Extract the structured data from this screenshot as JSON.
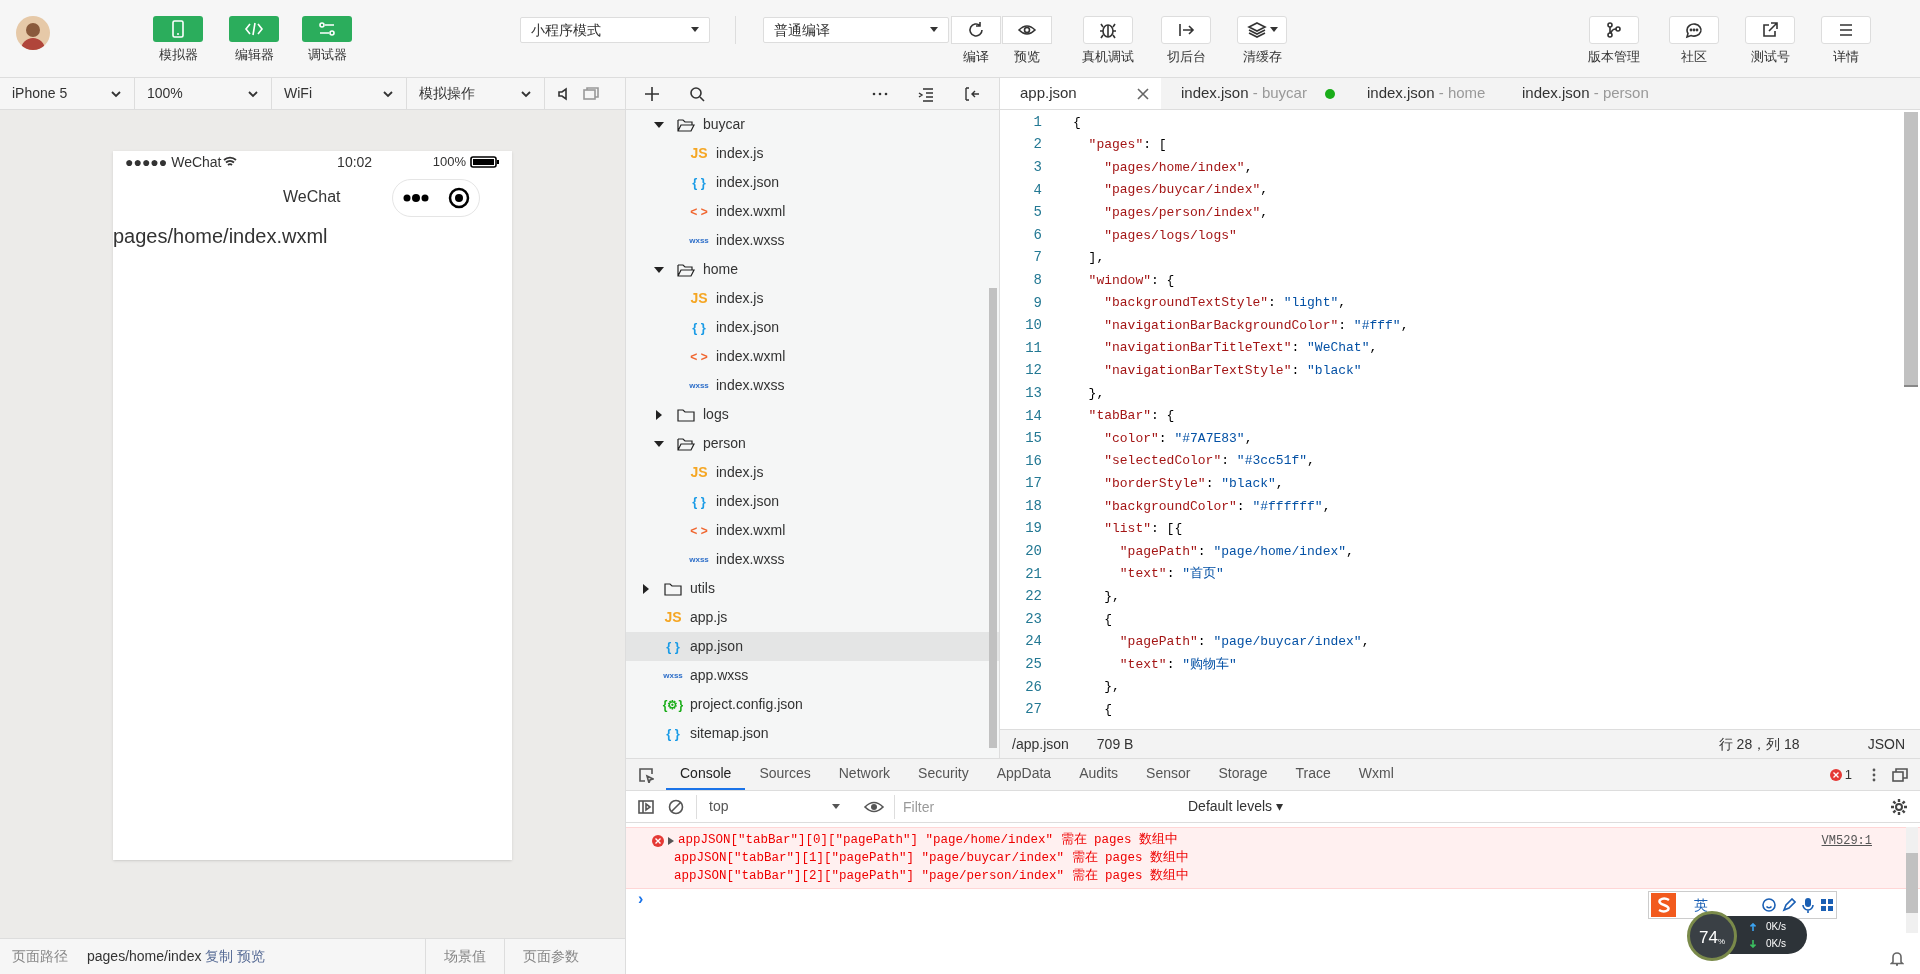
{
  "toolbar": {
    "views": [
      {
        "label": "模拟器",
        "kind": "phone",
        "selected": true
      },
      {
        "label": "编辑器",
        "kind": "code",
        "selected": true
      },
      {
        "label": "调试器",
        "kind": "debug",
        "selected": true
      }
    ],
    "mode_select": "小程序模式",
    "compile_select": "普通编译",
    "actions": [
      {
        "label": "编译",
        "kind": "refresh",
        "group": true
      },
      {
        "label": "预览",
        "kind": "eye",
        "group": true
      },
      {
        "label": "真机调试",
        "kind": "bug",
        "group": false
      },
      {
        "label": "切后台",
        "kind": "switch",
        "group": false
      },
      {
        "label": "清缓存",
        "kind": "layers",
        "group": false
      }
    ],
    "right_actions": [
      {
        "label": "版本管理",
        "kind": "branch"
      },
      {
        "label": "社区",
        "kind": "chat"
      },
      {
        "label": "测试号",
        "kind": "share"
      },
      {
        "label": "详情",
        "kind": "menu"
      }
    ]
  },
  "simulator": {
    "selects": [
      "iPhone 5",
      "100%",
      "WiFi",
      "模拟操作"
    ],
    "phone": {
      "carrier": "●●●●● WeChat",
      "time": "10:02",
      "battery": "100%",
      "title": "WeChat",
      "content": "pages/home/index.wxml"
    },
    "footer": {
      "path_label": "页面路径",
      "path": "pages/home/index",
      "copy": "复制",
      "preview": "预览",
      "scene": "场景值",
      "params": "页面参数"
    }
  },
  "file_tree": [
    {
      "children": [
        {
          "name": "buycar",
          "kind": "folder",
          "expanded": true,
          "children": [
            {
              "name": "index.js",
              "kind": "js",
              "icon": "JS"
            },
            {
              "name": "index.json",
              "kind": "json",
              "icon": "{ }"
            },
            {
              "name": "index.wxml",
              "kind": "wxml",
              "icon": "< >"
            },
            {
              "name": "index.wxss",
              "kind": "wxss",
              "icon": "wxss"
            }
          ]
        },
        {
          "name": "home",
          "kind": "folder",
          "expanded": true,
          "children": [
            {
              "name": "index.js",
              "kind": "js",
              "icon": "JS"
            },
            {
              "name": "index.json",
              "kind": "json",
              "icon": "{ }"
            },
            {
              "name": "index.wxml",
              "kind": "wxml",
              "icon": "< >"
            },
            {
              "name": "index.wxss",
              "kind": "wxss",
              "icon": "wxss"
            }
          ]
        },
        {
          "name": "logs",
          "kind": "folder",
          "expanded": false
        },
        {
          "name": "person",
          "kind": "folder",
          "expanded": true,
          "children": [
            {
              "name": "index.js",
              "kind": "js",
              "icon": "JS"
            },
            {
              "name": "index.json",
              "kind": "json",
              "icon": "{ }"
            },
            {
              "name": "index.wxml",
              "kind": "wxml",
              "icon": "< >"
            },
            {
              "name": "index.wxss",
              "kind": "wxss",
              "icon": "wxss"
            }
          ]
        }
      ]
    },
    {
      "name": "utils",
      "kind": "folder",
      "expanded": false
    },
    {
      "name": "app.js",
      "kind": "js",
      "icon": "JS",
      "selected": false
    },
    {
      "name": "app.json",
      "kind": "json",
      "icon": "{ }",
      "selected": true
    },
    {
      "name": "app.wxss",
      "kind": "wxss",
      "icon": "wxss",
      "selected": false
    },
    {
      "name": "project.config.json",
      "kind": "config",
      "icon": "{⚙}",
      "selected": false
    },
    {
      "name": "sitemap.json",
      "kind": "json",
      "icon": "{ }",
      "selected": false
    }
  ],
  "editor": {
    "tabs": [
      {
        "file": "app.json",
        "selected": true,
        "modified": false
      },
      {
        "file": "index.json",
        "folder": " - buycar",
        "selected": false,
        "modified": true
      },
      {
        "file": "index.json",
        "folder": " - home",
        "selected": false,
        "modified": false
      },
      {
        "file": "index.json",
        "folder": " - person",
        "selected": false,
        "modified": false
      }
    ],
    "lines": [
      {
        "number": "1",
        "tokens": [
          {
            "kind": "punct",
            "text": "{"
          }
        ]
      },
      {
        "number": "2",
        "tokens": [
          {
            "kind": "key",
            "text": "  \"pages\""
          },
          {
            "kind": "punct",
            "text": ": ["
          }
        ]
      },
      {
        "number": "3",
        "tokens": [
          {
            "kind": "key",
            "text": "    \"pages/home/index\""
          },
          {
            "kind": "punct",
            "text": ","
          }
        ]
      },
      {
        "number": "4",
        "tokens": [
          {
            "kind": "key",
            "text": "    \"pages/buycar/index\""
          },
          {
            "kind": "punct",
            "text": ","
          }
        ]
      },
      {
        "number": "5",
        "tokens": [
          {
            "kind": "key",
            "text": "    \"pages/person/index\""
          },
          {
            "kind": "punct",
            "text": ","
          }
        ]
      },
      {
        "number": "6",
        "tokens": [
          {
            "kind": "key",
            "text": "    \"pages/logs/logs\""
          }
        ]
      },
      {
        "number": "7",
        "tokens": [
          {
            "kind": "punct",
            "text": "  ],"
          }
        ]
      },
      {
        "number": "8",
        "tokens": [
          {
            "kind": "key",
            "text": "  \"window\""
          },
          {
            "kind": "punct",
            "text": ": {"
          }
        ]
      },
      {
        "number": "9",
        "tokens": [
          {
            "kind": "key",
            "text": "    \"backgroundTextStyle\""
          },
          {
            "kind": "punct",
            "text": ": "
          },
          {
            "kind": "value",
            "text": "\"light\""
          },
          {
            "kind": "punct",
            "text": ","
          }
        ]
      },
      {
        "number": "10",
        "tokens": [
          {
            "kind": "key",
            "text": "    \"navigationBarBackgroundColor\""
          },
          {
            "kind": "punct",
            "text": ": "
          },
          {
            "kind": "value",
            "text": "\"#fff\""
          },
          {
            "kind": "punct",
            "text": ","
          }
        ]
      },
      {
        "number": "11",
        "tokens": [
          {
            "kind": "key",
            "text": "    \"navigationBarTitleText\""
          },
          {
            "kind": "punct",
            "text": ": "
          },
          {
            "kind": "value",
            "text": "\"WeChat\""
          },
          {
            "kind": "punct",
            "text": ","
          }
        ]
      },
      {
        "number": "12",
        "tokens": [
          {
            "kind": "key",
            "text": "    \"navigationBarTextStyle\""
          },
          {
            "kind": "punct",
            "text": ": "
          },
          {
            "kind": "value",
            "text": "\"black\""
          }
        ]
      },
      {
        "number": "13",
        "tokens": [
          {
            "kind": "punct",
            "text": "  },"
          }
        ]
      },
      {
        "number": "14",
        "tokens": [
          {
            "kind": "key",
            "text": "  \"tabBar\""
          },
          {
            "kind": "punct",
            "text": ": {"
          }
        ]
      },
      {
        "number": "15",
        "tokens": [
          {
            "kind": "key",
            "text": "    \"color\""
          },
          {
            "kind": "punct",
            "text": ": "
          },
          {
            "kind": "value",
            "text": "\"#7A7E83\""
          },
          {
            "kind": "punct",
            "text": ","
          }
        ]
      },
      {
        "number": "16",
        "tokens": [
          {
            "kind": "key",
            "text": "    \"selectedColor\""
          },
          {
            "kind": "punct",
            "text": ": "
          },
          {
            "kind": "value",
            "text": "\"#3cc51f\""
          },
          {
            "kind": "punct",
            "text": ","
          }
        ]
      },
      {
        "number": "17",
        "tokens": [
          {
            "kind": "key",
            "text": "    \"borderStyle\""
          },
          {
            "kind": "punct",
            "text": ": "
          },
          {
            "kind": "value",
            "text": "\"black\""
          },
          {
            "kind": "punct",
            "text": ","
          }
        ]
      },
      {
        "number": "18",
        "tokens": [
          {
            "kind": "key",
            "text": "    \"backgroundColor\""
          },
          {
            "kind": "punct",
            "text": ": "
          },
          {
            "kind": "value",
            "text": "\"#ffffff\""
          },
          {
            "kind": "punct",
            "text": ","
          }
        ]
      },
      {
        "number": "19",
        "tokens": [
          {
            "kind": "key",
            "text": "    \"list\""
          },
          {
            "kind": "punct",
            "text": ": [{"
          }
        ]
      },
      {
        "number": "20",
        "tokens": [
          {
            "kind": "key",
            "text": "      \"pagePath\""
          },
          {
            "kind": "punct",
            "text": ": "
          },
          {
            "kind": "value",
            "text": "\"page/home/index\""
          },
          {
            "kind": "punct",
            "text": ","
          }
        ]
      },
      {
        "number": "21",
        "tokens": [
          {
            "kind": "key",
            "text": "      \"text\""
          },
          {
            "kind": "punct",
            "text": ": "
          },
          {
            "kind": "value",
            "text": "\"首页\""
          }
        ]
      },
      {
        "number": "22",
        "tokens": [
          {
            "kind": "punct",
            "text": "    },"
          }
        ]
      },
      {
        "number": "23",
        "tokens": [
          {
            "kind": "punct",
            "text": "    {"
          }
        ]
      },
      {
        "number": "24",
        "tokens": [
          {
            "kind": "key",
            "text": "      \"pagePath\""
          },
          {
            "kind": "punct",
            "text": ": "
          },
          {
            "kind": "value",
            "text": "\"page/buycar/index\""
          },
          {
            "kind": "punct",
            "text": ","
          }
        ]
      },
      {
        "number": "25",
        "tokens": [
          {
            "kind": "key",
            "text": "      \"text\""
          },
          {
            "kind": "punct",
            "text": ": "
          },
          {
            "kind": "value",
            "text": "\"购物车\""
          }
        ]
      },
      {
        "number": "26",
        "tokens": [
          {
            "kind": "punct",
            "text": "    },"
          }
        ]
      },
      {
        "number": "27",
        "tokens": [
          {
            "kind": "punct",
            "text": "    {"
          }
        ]
      }
    ],
    "status": {
      "path": "/app.json",
      "size": "709 B",
      "cursor": "行 28，列 18",
      "language": "JSON"
    }
  },
  "devtools": {
    "tabs": [
      {
        "label": "Console",
        "selected": true
      },
      {
        "label": "Sources",
        "selected": false
      },
      {
        "label": "Network",
        "selected": false
      },
      {
        "label": "Security",
        "selected": false
      },
      {
        "label": "AppData",
        "selected": false
      },
      {
        "label": "Audits",
        "selected": false
      },
      {
        "label": "Sensor",
        "selected": false
      },
      {
        "label": "Storage",
        "selected": false
      },
      {
        "label": "Trace",
        "selected": false
      },
      {
        "label": "Wxml",
        "selected": false
      }
    ],
    "error_count": "1",
    "context": "top",
    "filter_placeholder": "Filter",
    "levels": "Default levels ▾",
    "messages": [
      {
        "kind": "error",
        "lines": [
          "appJSON[\"tabBar\"][0][\"pagePath\"] \"page/home/index\" 需在 pages 数组中",
          "appJSON[\"tabBar\"][1][\"pagePath\"] \"page/buycar/index\" 需在 pages 数组中",
          "appJSON[\"tabBar\"][2][\"pagePath\"] \"page/person/index\" 需在 pages 数组中"
        ],
        "source": "VM529:1"
      }
    ],
    "prompt": "›"
  },
  "overlays": {
    "ime_label": "英",
    "speed_percent": "74",
    "percent_sign": "%",
    "upload": "0K/s",
    "download": "0K/s"
  }
}
